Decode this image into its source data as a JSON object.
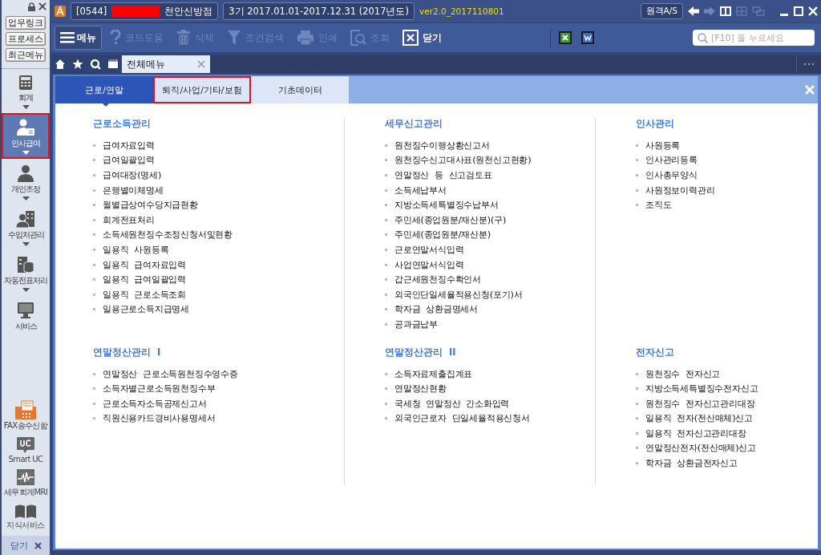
{
  "sidebar": {
    "quick_buttons": [
      "업무링크",
      "프로세스",
      "최근메뉴"
    ],
    "items": [
      {
        "label": "회계",
        "kind": "calculator",
        "selected": false,
        "highlighted": false,
        "expandable": true
      },
      {
        "label": "인사급여",
        "kind": "person-doc",
        "selected": true,
        "highlighted": true,
        "expandable": true
      },
      {
        "label": "개인조정",
        "kind": "person",
        "selected": false,
        "highlighted": false,
        "expandable": true
      },
      {
        "label": "수임처관리",
        "kind": "person-building",
        "selected": false,
        "highlighted": false,
        "expandable": true
      },
      {
        "label": "자동전표처리",
        "kind": "database",
        "selected": false,
        "highlighted": false,
        "expandable": true
      },
      {
        "label": "서비스",
        "kind": "monitor",
        "selected": false,
        "highlighted": false,
        "expandable": false
      }
    ],
    "tools": [
      {
        "label": "FAX송수신함",
        "kind": "fax"
      },
      {
        "label": "Smart UC",
        "kind": "uc"
      },
      {
        "label": "세무회계MRI",
        "kind": "pulse"
      },
      {
        "label": "지식서비스",
        "kind": "book"
      }
    ],
    "close": "닫기"
  },
  "header": {
    "company_code": "[0544]",
    "company_name": "천안신방점",
    "period": "3기  2017.01.01-2017.12.31  (2017년도)",
    "version": "ver2.0_2017110801",
    "remote_button": "원격A/S"
  },
  "toolbar": {
    "menu_button": "메뉴",
    "items": [
      {
        "label": "코드도움",
        "kind": "help",
        "disabled": true
      },
      {
        "label": "삭제",
        "kind": "trash",
        "disabled": true
      },
      {
        "label": "조건검색",
        "kind": "filter",
        "disabled": true
      },
      {
        "label": "인쇄",
        "kind": "printer",
        "disabled": true
      },
      {
        "label": "조회",
        "kind": "search-doc",
        "disabled": true
      },
      {
        "label": "닫기",
        "kind": "close-box",
        "disabled": false
      }
    ],
    "search": {
      "placeholder": "[F10] 을 누르세요"
    }
  },
  "page_tabs": [
    {
      "label": "전체메뉴",
      "selected": true
    }
  ],
  "menu_tabs": [
    {
      "label": "근로/연말",
      "selected": true,
      "highlighted": false
    },
    {
      "label": "퇴직/사업/기타/보험",
      "selected": false,
      "highlighted": true
    },
    {
      "label": "기초데이터",
      "selected": false,
      "highlighted": false
    }
  ],
  "sections": [
    {
      "title": "근로소득관리",
      "items": [
        "급여자료입력",
        "급여일괄입력",
        "급여대장(명세)",
        "은행별이체명세",
        "월별급상여수당지급현황",
        "회계전표처리",
        "소득세원천징수조정신청서및현황",
        "일용직  사원등록",
        "일용직  급여자료입력",
        "일용직  급여일괄입력",
        "일용직  근로소득조회",
        "일용근로소득지급명세"
      ]
    },
    {
      "title": "세무신고관리",
      "items": [
        "원천징수이행상황신고서",
        "원천징수신고대사표(원천신고현황)",
        "연말정산  등  신고검토표",
        "소득세납부서",
        "지방소득세특별징수납부서",
        "주민세(종업원분/재산분)(구)",
        "주민세(종업원분/재산분)",
        "근로연말서식입력",
        "사업연말서식입력",
        "갑근세원천징수확인서",
        "외국인단일세율적용신청(포기)서",
        "학자금  상환금명세서",
        "공과금납부"
      ]
    },
    {
      "title": "인사관리",
      "items": [
        "사원등록",
        "인사관리등록",
        "인사총무양식",
        "사원정보이력관리",
        "조직도"
      ]
    },
    {
      "title": "연말정산관리  I",
      "items": [
        "연말정산  근로소득원천징수영수증",
        "소득자별근로소득원천징수부",
        "근로소득자소득공제신고서",
        "직원신용카드경비사용명세서"
      ]
    },
    {
      "title": "연말정산관리  II",
      "items": [
        "소득자료제출집계표",
        "연말정산현황",
        "국세청  연말정산  간소화입력",
        "외국인근로자  단일세율적용신청서"
      ]
    },
    {
      "title": "전자신고",
      "items": [
        "원천징수  전자신고",
        "지방소득세특별징수전자신고",
        "원천징수  전자신고관리대장",
        "일용직  전자(전산매체)신고",
        "일용직  전자신고관리대장",
        "연말정산전자(전산매체)신고",
        "학자금  상환금전자신고"
      ]
    }
  ]
}
